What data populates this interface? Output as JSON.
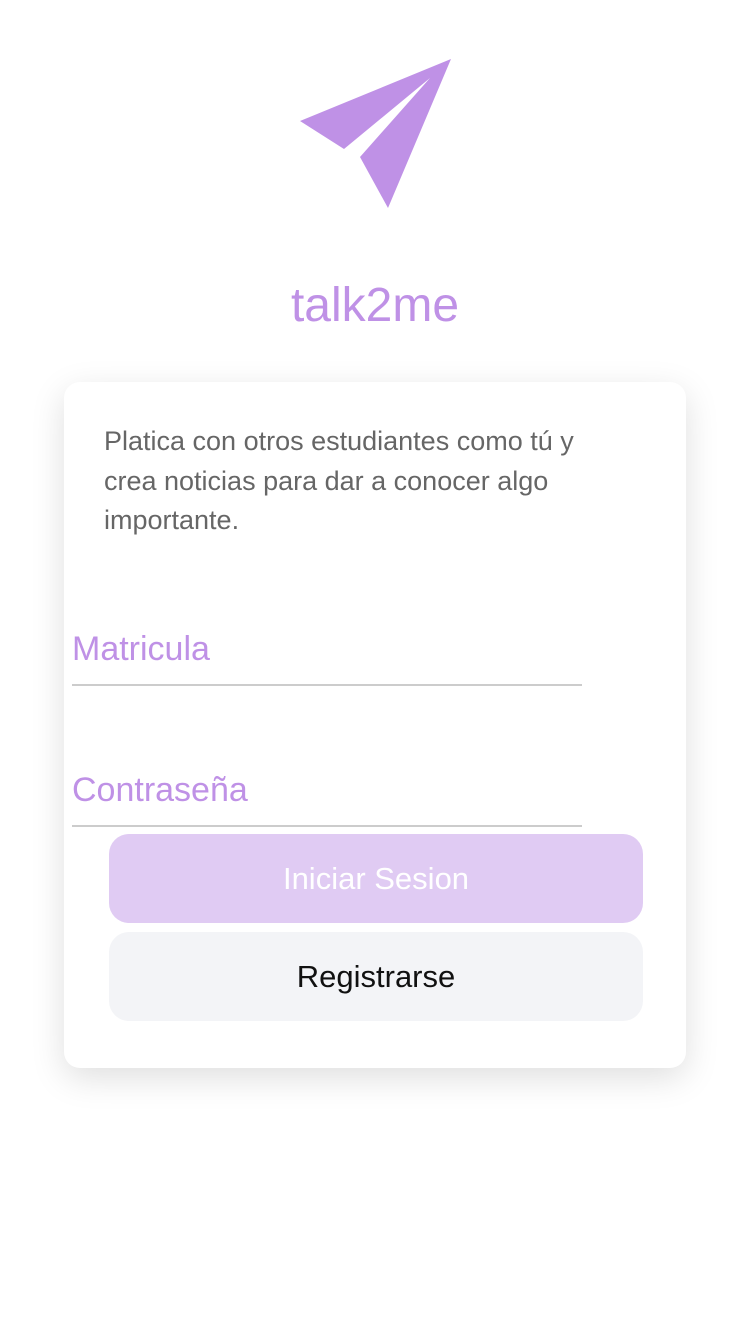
{
  "logo": {
    "icon": "paper-plane-icon",
    "color": "#bf91e6"
  },
  "app_name": "talk2me",
  "card": {
    "tagline": "Platica con otros estudiantes como tú y crea noticias para dar a conocer algo importante."
  },
  "form": {
    "matricula_placeholder": "Matricula",
    "matricula_value": "",
    "password_placeholder": "Contraseña",
    "password_value": "",
    "login_label": "Iniciar Sesion",
    "register_label": "Registrarse"
  },
  "colors": {
    "accent": "#bf91e6",
    "login_button_bg": "#e0cbf3",
    "register_button_bg": "#f3f4f7",
    "tagline_text": "#666666"
  }
}
